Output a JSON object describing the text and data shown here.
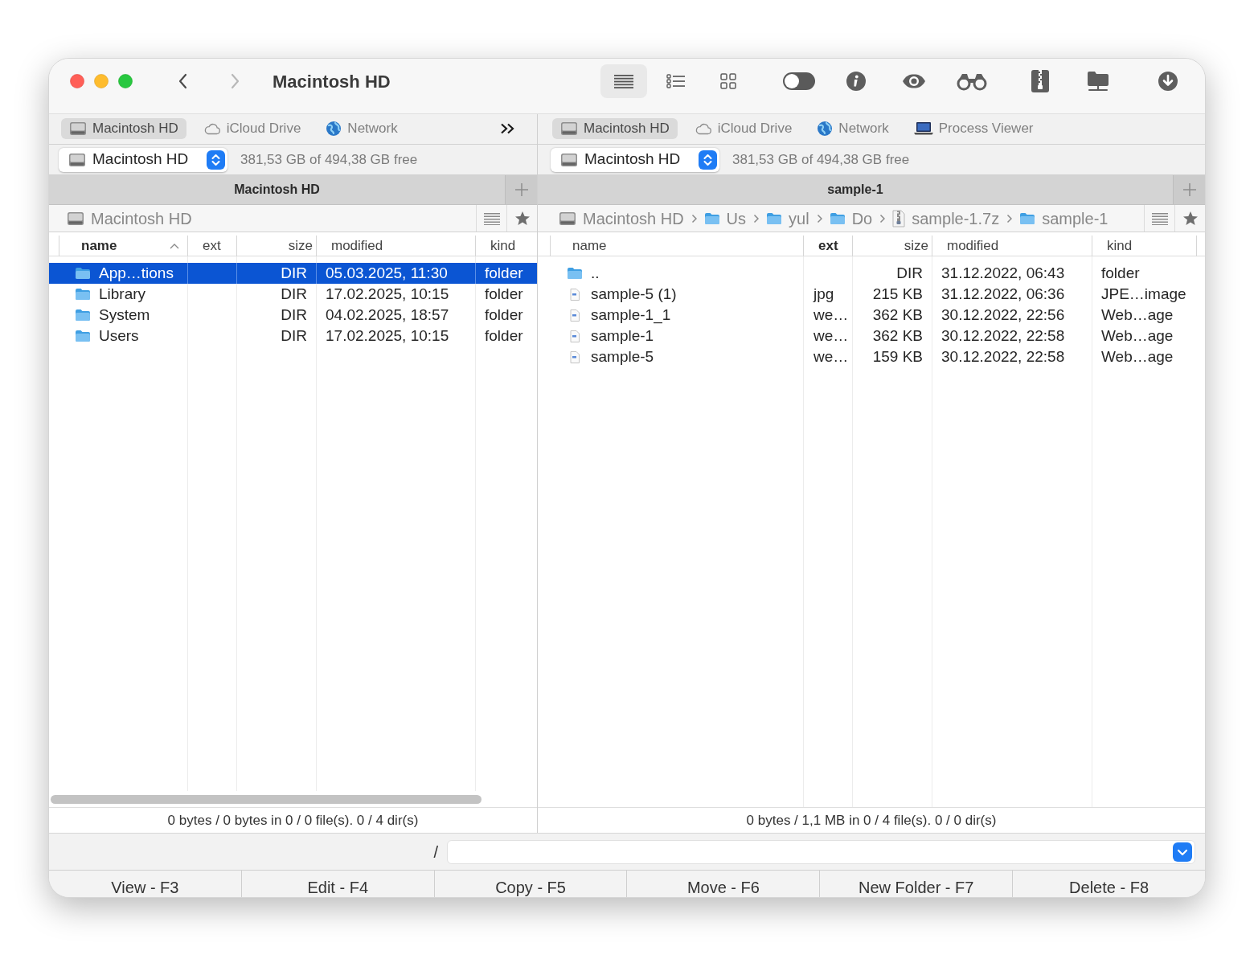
{
  "window": {
    "title": "Macintosh HD"
  },
  "navigation": [
    {
      "kind": "back",
      "disabled": false
    },
    {
      "kind": "forward",
      "disabled": true
    }
  ],
  "view_modes": [
    {
      "kind": "list",
      "selected": true
    },
    {
      "kind": "detail-list",
      "selected": false
    },
    {
      "kind": "grid",
      "selected": false
    }
  ],
  "toggle": {
    "on": false
  },
  "toolbar": [
    {
      "kind": "info"
    },
    {
      "kind": "eye"
    },
    {
      "kind": "binoculars"
    },
    {
      "kind": "archive"
    },
    {
      "kind": "network-drive"
    },
    {
      "kind": "download"
    }
  ],
  "panels": [
    {
      "tabs": [
        {
          "kind": "drive",
          "label": "Macintosh HD",
          "selected": true
        },
        {
          "kind": "cloud",
          "label": "iCloud Drive",
          "selected": false
        },
        {
          "kind": "globe",
          "label": "Network",
          "selected": false
        }
      ],
      "tab_overflow": true,
      "volume": {
        "name": "Macintosh HD",
        "free": "381,53 GB of 494,38 GB free"
      },
      "header": {
        "title": "Macintosh HD"
      },
      "path": [
        {
          "kind": "drive",
          "label": "Macintosh HD"
        }
      ],
      "columns": [
        {
          "label": "name",
          "sorted": true,
          "sort_arrow": true
        },
        {
          "label": "ext",
          "sorted": false,
          "sort_arrow": false
        },
        {
          "label": "size",
          "sorted": false,
          "sort_arrow": false
        },
        {
          "label": "modified",
          "sorted": false,
          "sort_arrow": false
        },
        {
          "label": "kind",
          "sorted": false,
          "sort_arrow": false
        }
      ],
      "rows": [
        {
          "kind": "folder",
          "name": "App…tions",
          "size": "DIR",
          "modified": "05.03.2025, 11:30",
          "type": "folder",
          "selected": true
        },
        {
          "kind": "folder",
          "name": "Library",
          "size": "DIR",
          "modified": "17.02.2025, 10:15",
          "type": "folder",
          "selected": false
        },
        {
          "kind": "folder",
          "name": "System",
          "size": "DIR",
          "modified": "04.02.2025, 18:57",
          "type": "folder",
          "selected": false
        },
        {
          "kind": "folder",
          "name": "Users",
          "size": "DIR",
          "modified": "17.02.2025, 10:15",
          "type": "folder",
          "selected": false
        }
      ],
      "horizontal_scrollbar": true,
      "status": "0 bytes / 0 bytes in 0 / 0 file(s). 0 / 4 dir(s)"
    },
    {
      "tabs": [
        {
          "kind": "drive",
          "label": "Macintosh HD",
          "selected": true
        },
        {
          "kind": "cloud",
          "label": "iCloud Drive",
          "selected": false
        },
        {
          "kind": "globe",
          "label": "Network",
          "selected": false
        },
        {
          "kind": "laptop",
          "label": "Process Viewer",
          "selected": false
        }
      ],
      "volume": {
        "name": "Macintosh HD",
        "free": "381,53 GB of 494,38 GB free"
      },
      "header": {
        "title": "sample-1"
      },
      "path": [
        {
          "kind": "drive",
          "label": "Macintosh HD"
        },
        {
          "kind": "folder",
          "label": "Us"
        },
        {
          "kind": "folder",
          "label": "yul"
        },
        {
          "kind": "folder",
          "label": "Do"
        },
        {
          "kind": "archive",
          "label": "sample-1.7z"
        },
        {
          "kind": "folder",
          "label": "sample-1"
        }
      ],
      "columns": [
        {
          "label": "name",
          "sorted": false,
          "sort_arrow": false
        },
        {
          "label": "ext",
          "sorted": true,
          "sort_arrow": false
        },
        {
          "label": "size",
          "sorted": false,
          "sort_arrow": false
        },
        {
          "label": "modified",
          "sorted": false,
          "sort_arrow": false
        },
        {
          "label": "kind",
          "sorted": false,
          "sort_arrow": false
        }
      ],
      "rows": [
        {
          "kind": "folder",
          "name": "..",
          "size": "DIR",
          "modified": "31.12.2022, 06:43",
          "type": "folder",
          "selected": false
        },
        {
          "kind": "file",
          "name": "sample-5 (1)",
          "ext": "jpg",
          "size": "215 KB",
          "modified": "31.12.2022, 06:36",
          "type": "JPE…image",
          "selected": false
        },
        {
          "kind": "file",
          "name": "sample-1_1",
          "ext": "we…",
          "size": "362 KB",
          "modified": "30.12.2022, 22:56",
          "type": "Web…age",
          "selected": false
        },
        {
          "kind": "file",
          "name": "sample-1",
          "ext": "we…",
          "size": "362 KB",
          "modified": "30.12.2022, 22:58",
          "type": "Web…age",
          "selected": false
        },
        {
          "kind": "file",
          "name": "sample-5",
          "ext": "we…",
          "size": "159 KB",
          "modified": "30.12.2022, 22:58",
          "type": "Web…age",
          "selected": false
        }
      ],
      "status": "0 bytes / 1,1 MB in 0 / 4 file(s). 0 / 0 dir(s)"
    }
  ],
  "command_line": {
    "path": "/"
  },
  "function_keys": [
    "View - F3",
    "Edit - F4",
    "Copy - F5",
    "Move - F6",
    "New Folder - F7",
    "Delete - F8"
  ]
}
